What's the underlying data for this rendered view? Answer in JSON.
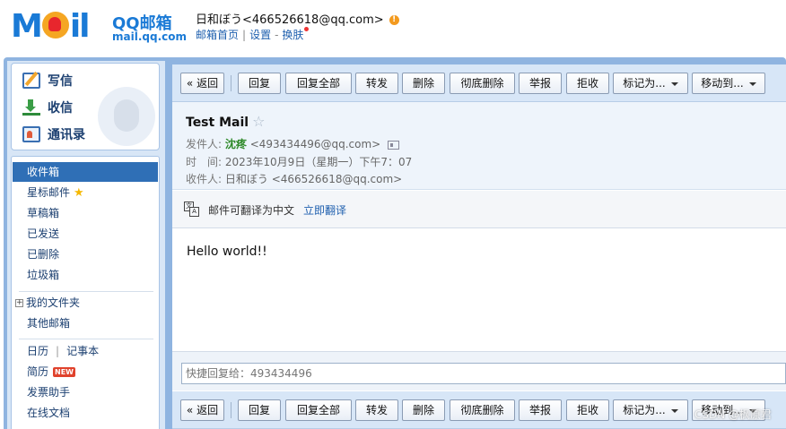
{
  "header": {
    "logo_word": "M",
    "logo_word2": "il",
    "brand": "QQ邮箱",
    "domain": "mail.qq.com",
    "user": "日和ぼう<466526618@qq.com>",
    "warn": "!",
    "links": [
      "邮箱首页",
      "设置",
      "换肤"
    ],
    "sep1": "|",
    "sep2": "-"
  },
  "sidebar": {
    "compose": "写信",
    "inbox_btn": "收信",
    "contacts": "通讯录",
    "folders": {
      "inbox": "收件箱",
      "starred": "星标邮件",
      "drafts": "草稿箱",
      "sent": "已发送",
      "deleted": "已删除",
      "trash": "垃圾箱",
      "my_folders": "我的文件夹",
      "other_mailbox": "其他邮箱",
      "calendar": "日历",
      "notes": "记事本",
      "resume": "简历",
      "new_badge": "NEW",
      "invoice": "发票助手",
      "docs": "在线文档"
    },
    "link_sep": "|"
  },
  "toolbar": {
    "back": "« 返回",
    "reply": "回复",
    "reply_all": "回复全部",
    "forward": "转发",
    "delete": "删除",
    "perm_delete": "彻底删除",
    "report": "举报",
    "reject": "拒收",
    "mark_as": "标记为...",
    "move_to": "移动到..."
  },
  "mail": {
    "subject": "Test Mail",
    "star": "☆",
    "from_label": "发件人:",
    "from_name": "沈疼",
    "from_addr": "<493434496@qq.com>",
    "time_label": "时　间:",
    "time_value": "2023年10月9日（星期一）下午7：07",
    "to_label": "收件人:",
    "to_value": "日和ぼう <466526618@qq.com>",
    "translate_text": "邮件可翻译为中文",
    "translate_link": "立即翻译",
    "body": "Hello world!!",
    "quick_reply_placeholder": "快捷回复给：493434496"
  },
  "watermark": "CSDN @枫原君"
}
